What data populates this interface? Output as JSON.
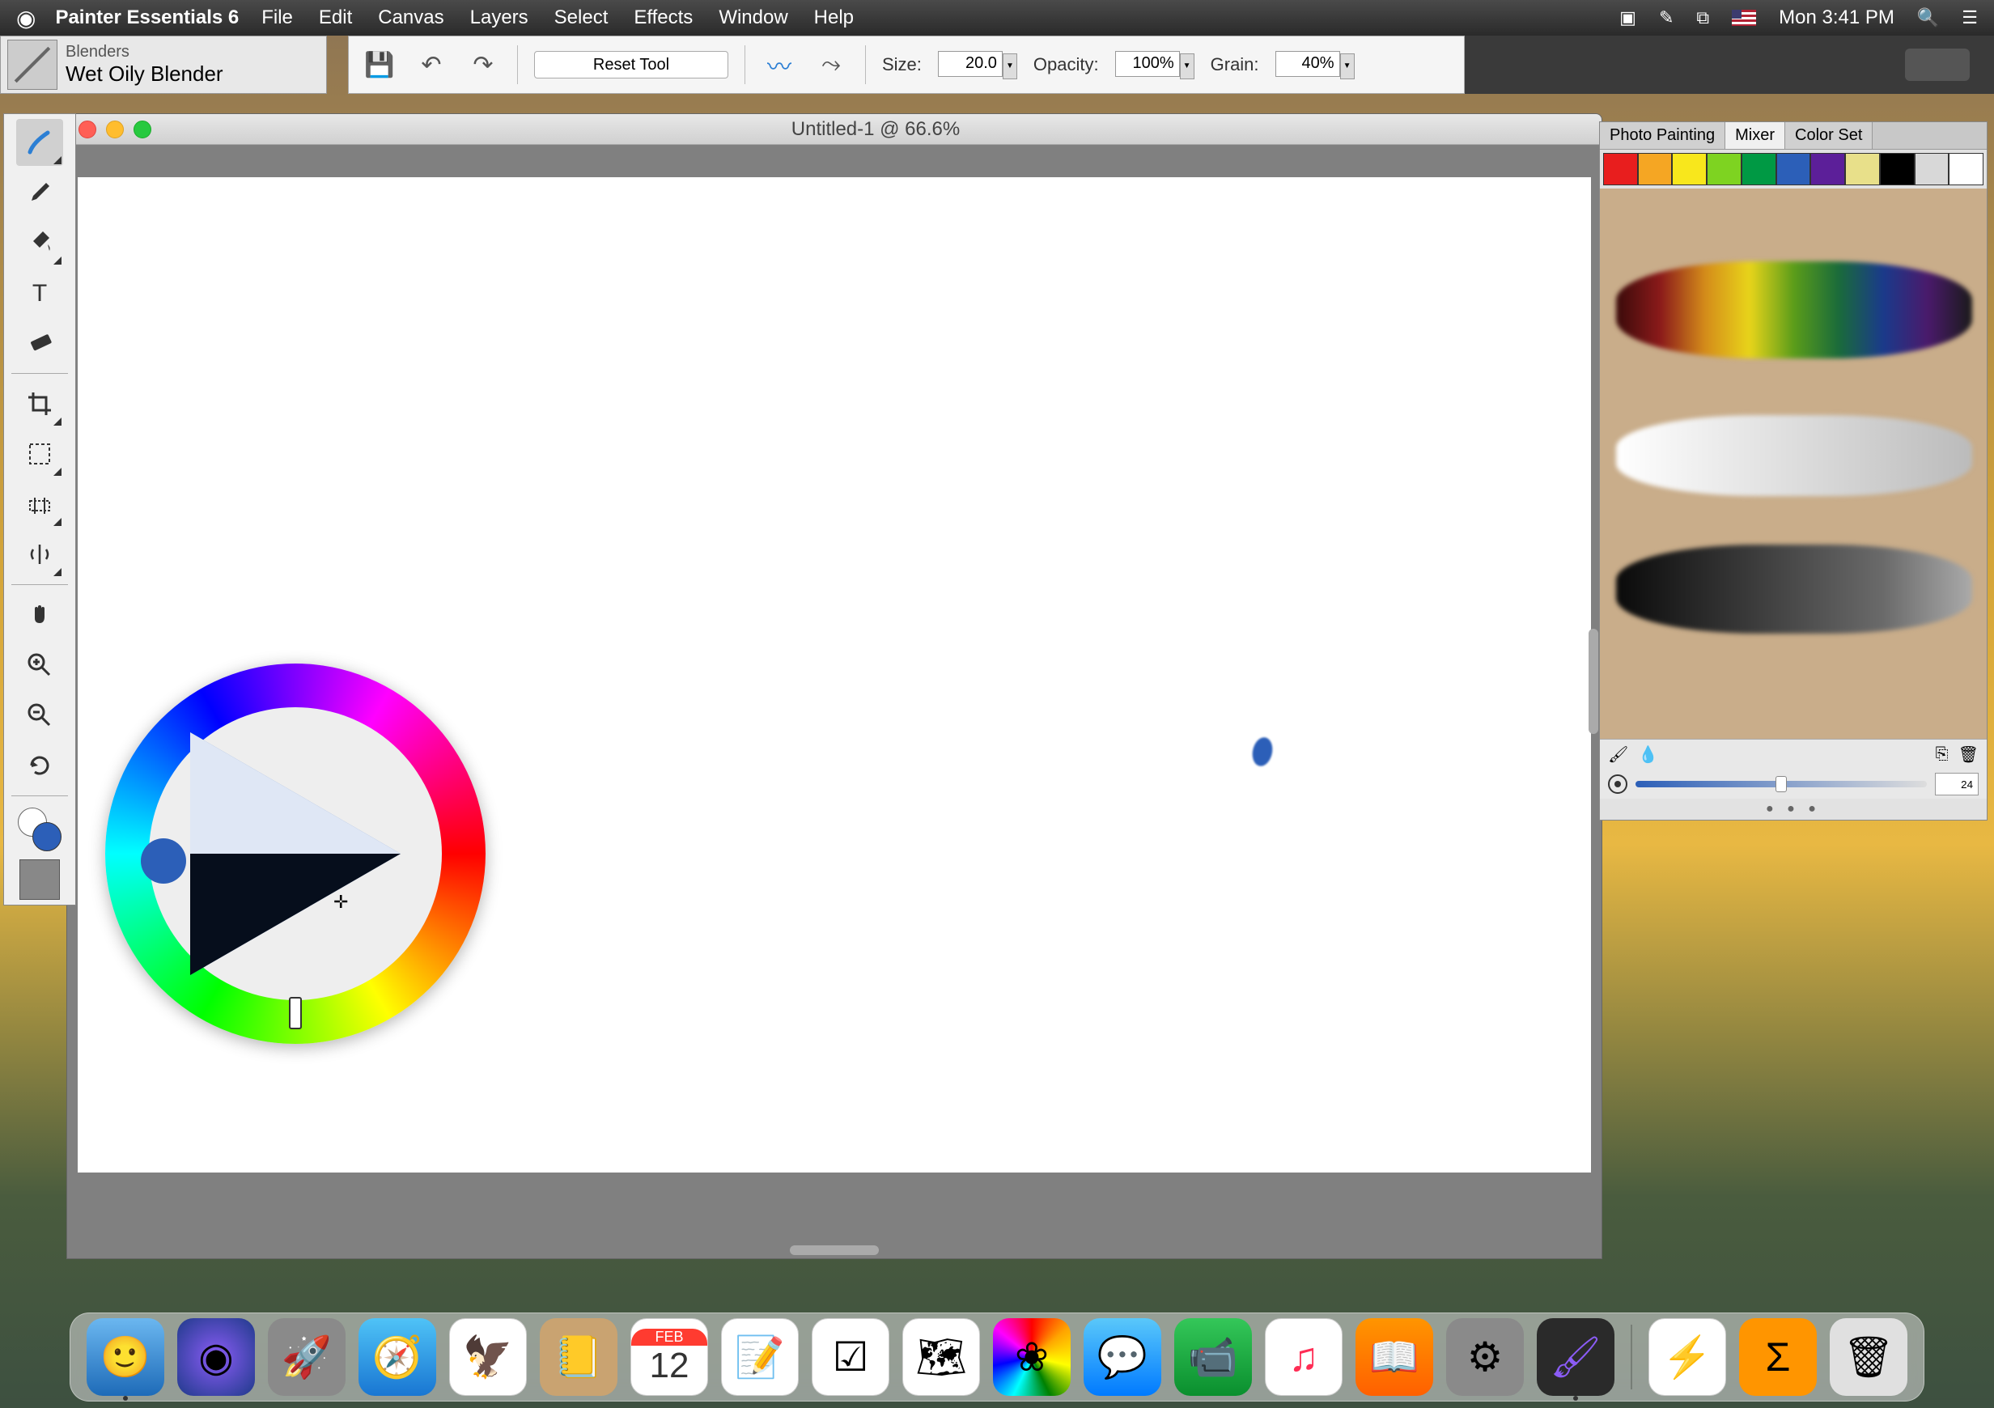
{
  "menubar": {
    "app_name": "Painter Essentials 6",
    "items": [
      "File",
      "Edit",
      "Canvas",
      "Layers",
      "Select",
      "Effects",
      "Window",
      "Help"
    ],
    "clock": "Mon 3:41 PM"
  },
  "brush": {
    "category": "Blenders",
    "name": "Wet Oily Blender"
  },
  "options": {
    "reset_label": "Reset Tool",
    "size_label": "Size:",
    "size_value": "20.0",
    "opacity_label": "Opacity:",
    "opacity_value": "100%",
    "grain_label": "Grain:",
    "grain_value": "40%"
  },
  "document": {
    "title": "Untitled-1 @ 66.6%"
  },
  "panel": {
    "tabs": [
      "Photo Painting",
      "Mixer",
      "Color Set"
    ],
    "active_tab": "Mixer",
    "swatches": [
      "#e81e1e",
      "#f5a623",
      "#f8e71c",
      "#7ed321",
      "#009944",
      "#2c5fb8",
      "#5c1f99",
      "#e8e08a",
      "#000000",
      "#d8d8d8",
      "#ffffff"
    ],
    "mixer_size": "24"
  },
  "current_color": "#2c5fb8",
  "tools": [
    "brush",
    "dropper",
    "bucket",
    "text",
    "eraser",
    "crop",
    "marquee",
    "selection-adjust",
    "symmetry",
    "hand",
    "zoom-in",
    "zoom-out",
    "rotate"
  ],
  "dock": {
    "items": [
      "finder",
      "siri",
      "launchpad",
      "safari",
      "mail",
      "contacts",
      "calendar",
      "notes",
      "reminders",
      "maps",
      "photos",
      "messages",
      "facetime",
      "itunes",
      "ibooks",
      "preferences",
      "painter",
      "downloads",
      "app1",
      "app2",
      "trash"
    ],
    "calendar_day": "12",
    "calendar_month": "FEB"
  }
}
